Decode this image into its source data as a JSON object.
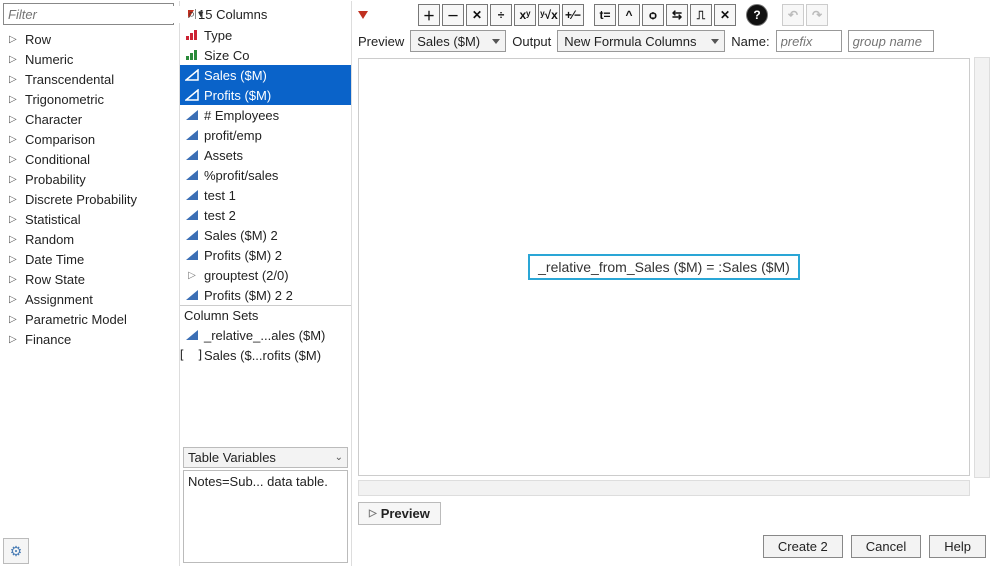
{
  "left": {
    "filter_placeholder": "Filter",
    "categories": [
      "Row",
      "Numeric",
      "Transcendental",
      "Trigonometric",
      "Character",
      "Comparison",
      "Conditional",
      "Probability",
      "Discrete Probability",
      "Statistical",
      "Random",
      "Date Time",
      "Row State",
      "Assignment",
      "Parametric Model",
      "Finance"
    ]
  },
  "middle": {
    "columns_header": "15 Columns",
    "columns": [
      {
        "label": "Type",
        "icon": "bars-red",
        "sel": false
      },
      {
        "label": "Size Co",
        "icon": "bars-green",
        "sel": false
      },
      {
        "label": "Sales ($M)",
        "icon": "tri-blue-open",
        "sel": true
      },
      {
        "label": "Profits ($M)",
        "icon": "tri-blue-open",
        "sel": true
      },
      {
        "label": "# Employees",
        "icon": "tri-blue",
        "sel": false
      },
      {
        "label": "profit/emp",
        "icon": "tri-blue",
        "sel": false
      },
      {
        "label": "Assets",
        "icon": "tri-blue",
        "sel": false
      },
      {
        "label": "%profit/sales",
        "icon": "tri-blue",
        "sel": false
      },
      {
        "label": "test 1",
        "icon": "tri-blue",
        "sel": false
      },
      {
        "label": "test 2",
        "icon": "tri-blue",
        "sel": false
      },
      {
        "label": "Sales ($M) 2",
        "icon": "tri-blue",
        "sel": false
      },
      {
        "label": "Profits ($M) 2",
        "icon": "tri-blue",
        "sel": false
      },
      {
        "label": "grouptest (2/0)",
        "icon": "disclosure",
        "sel": false
      },
      {
        "label": "Profits ($M) 2 2",
        "icon": "tri-blue",
        "sel": false
      }
    ],
    "colsets_header": "Column Sets",
    "colsets": [
      {
        "label": "_relative_...ales ($M)",
        "icon": "tri-blue"
      },
      {
        "label": "Sales ($...rofits ($M)",
        "icon": "brackets"
      }
    ],
    "table_variables_label": "Table Variables",
    "notes_text": "Notes=Sub... data table."
  },
  "right": {
    "toolbar": {
      "add": "＋",
      "sub": "－",
      "mul": "✕",
      "div": "÷",
      "pow": "xʸ",
      "root": "ʸ√x",
      "pm": "+⁄−",
      "assign": "t=",
      "peek": "^",
      "loop": "ѻ",
      "swap": "⇆",
      "anchor": "⎍",
      "del": "✕",
      "help": "?",
      "undo": "↶",
      "redo": "↷"
    },
    "row2": {
      "preview_label": "Preview",
      "preview_value": "Sales ($M)",
      "output_label": "Output",
      "output_value": "New Formula Columns",
      "name_label": "Name:",
      "name_placeholder": "prefix",
      "group_placeholder": "group name"
    },
    "formula": "_relative_from_Sales ($M) = :Sales ($M)",
    "preview_section": "Preview",
    "buttons": {
      "create": "Create 2",
      "cancel": "Cancel",
      "help": "Help"
    }
  }
}
